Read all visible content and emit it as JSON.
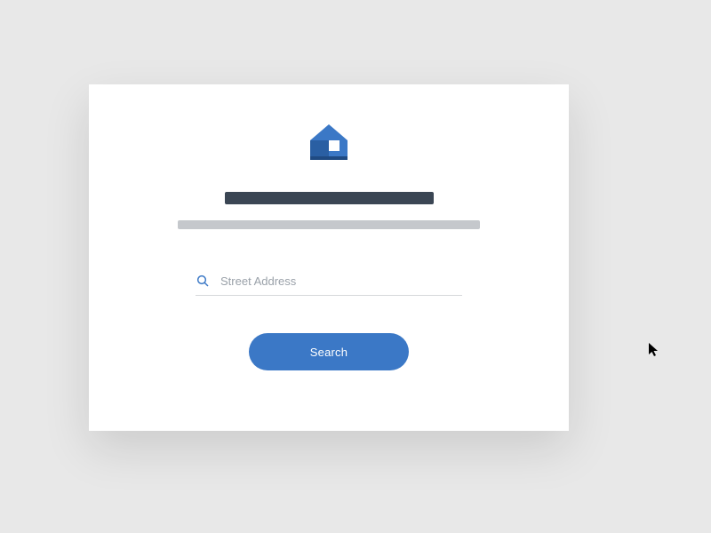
{
  "search": {
    "placeholder": "Street Address",
    "button_label": "Search"
  },
  "colors": {
    "accent": "#3b78c6",
    "heading": "#3b4654",
    "subheading": "#c5c8cc"
  }
}
